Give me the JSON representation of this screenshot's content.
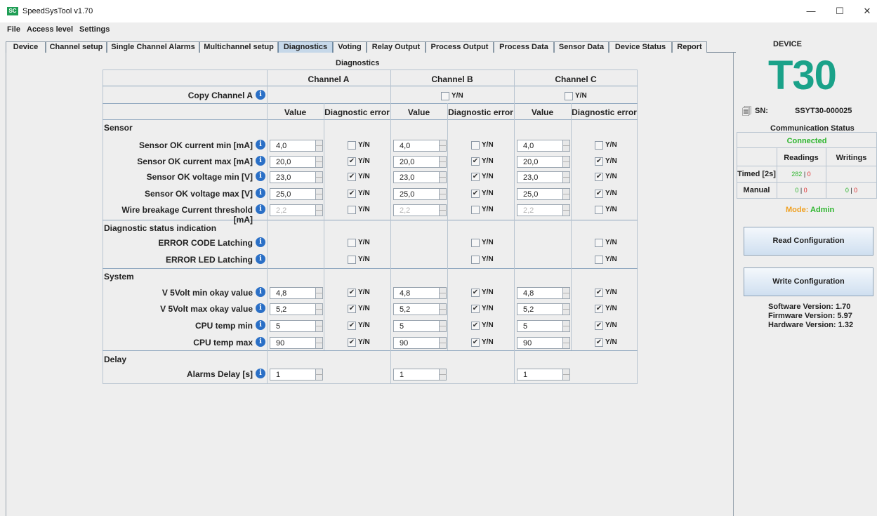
{
  "app": {
    "title": "SpeedSysTool v1.70",
    "icon_letters": "SC"
  },
  "window_controls": {
    "minimize": "—",
    "maximize": "☐",
    "close": "✕"
  },
  "menu": [
    "File",
    "Access level",
    "Settings"
  ],
  "tabs": [
    "Device",
    "Channel setup",
    "Single Channel Alarms",
    "Multichannel setup",
    "Diagnostics",
    "Voting",
    "Relay Output",
    "Process Output",
    "Process Data",
    "Sensor Data",
    "Device Status",
    "Report"
  ],
  "active_tab": "Diagnostics",
  "diagnostics": {
    "title": "Diagnostics",
    "channels": [
      "Channel A",
      "Channel B",
      "Channel C"
    ],
    "copy_label": "Copy Channel A",
    "yn": "Y/N",
    "col_value": "Value",
    "col_diag": "Diagnostic error",
    "copy_checked": [
      false,
      false
    ],
    "sections": {
      "sensor": "Sensor",
      "diag_status": "Diagnostic status indication",
      "system": "System",
      "delay": "Delay"
    },
    "rows": {
      "sensor": [
        {
          "label": "Sensor OK current min [mA]",
          "values": [
            "4,0",
            "4,0",
            "4,0"
          ],
          "checked": [
            false,
            false,
            false
          ]
        },
        {
          "label": "Sensor OK current max [mA]",
          "values": [
            "20,0",
            "20,0",
            "20,0"
          ],
          "checked": [
            true,
            true,
            true
          ]
        },
        {
          "label": "Sensor OK voltage min [V]",
          "values": [
            "23,0",
            "23,0",
            "23,0"
          ],
          "checked": [
            true,
            true,
            true
          ]
        },
        {
          "label": "Sensor OK voltage max [V]",
          "values": [
            "25,0",
            "25,0",
            "25,0"
          ],
          "checked": [
            true,
            true,
            true
          ]
        },
        {
          "label": "Wire breakage Current threshold [mA]",
          "values": [
            "2,2",
            "2,2",
            "2,2"
          ],
          "checked": [
            false,
            false,
            false
          ],
          "disabled": true
        }
      ],
      "diag_status": [
        {
          "label": "ERROR CODE Latching",
          "checked": [
            false,
            false,
            false
          ]
        },
        {
          "label": "ERROR LED Latching",
          "checked": [
            false,
            false,
            false
          ]
        }
      ],
      "system": [
        {
          "label": "V 5Volt min okay value",
          "values": [
            "4,8",
            "4,8",
            "4,8"
          ],
          "checked": [
            true,
            true,
            true
          ]
        },
        {
          "label": "V 5Volt max okay value",
          "values": [
            "5,2",
            "5,2",
            "5,2"
          ],
          "checked": [
            true,
            true,
            true
          ]
        },
        {
          "label": "CPU temp min",
          "values": [
            "5",
            "5",
            "5"
          ],
          "checked": [
            true,
            true,
            true
          ]
        },
        {
          "label": "CPU temp max",
          "values": [
            "90",
            "90",
            "90"
          ],
          "checked": [
            true,
            true,
            true
          ]
        }
      ],
      "delay": [
        {
          "label": "Alarms Delay [s]",
          "values": [
            "1",
            "1",
            "1"
          ]
        }
      ]
    }
  },
  "device": {
    "label": "DEVICE",
    "model": "T30",
    "sn_label": "SN:",
    "sn": "SSYT30-000025",
    "comm_title": "Communication Status",
    "comm_status": "Connected",
    "col_readings": "Readings",
    "col_writings": "Writings",
    "row_timed": "Timed [2s]",
    "row_manual": "Manual",
    "timed_readings_ok": "282",
    "timed_readings_err": "0",
    "manual_readings_ok": "0",
    "manual_readings_err": "0",
    "manual_writings_ok": "0",
    "manual_writings_err": "0",
    "mode_label": "Mode:",
    "mode_value": "Admin",
    "read_btn": "Read Configuration",
    "write_btn": "Write Configuration",
    "software": "Software Version: 1.70",
    "firmware": "Firmware Version: 5.97",
    "hardware": "Hardware Version: 1.32",
    "colors": {
      "brand": "#1aa289",
      "connected": "#2db52d",
      "error": "#e03030",
      "mode_label": "#f0a020"
    }
  }
}
